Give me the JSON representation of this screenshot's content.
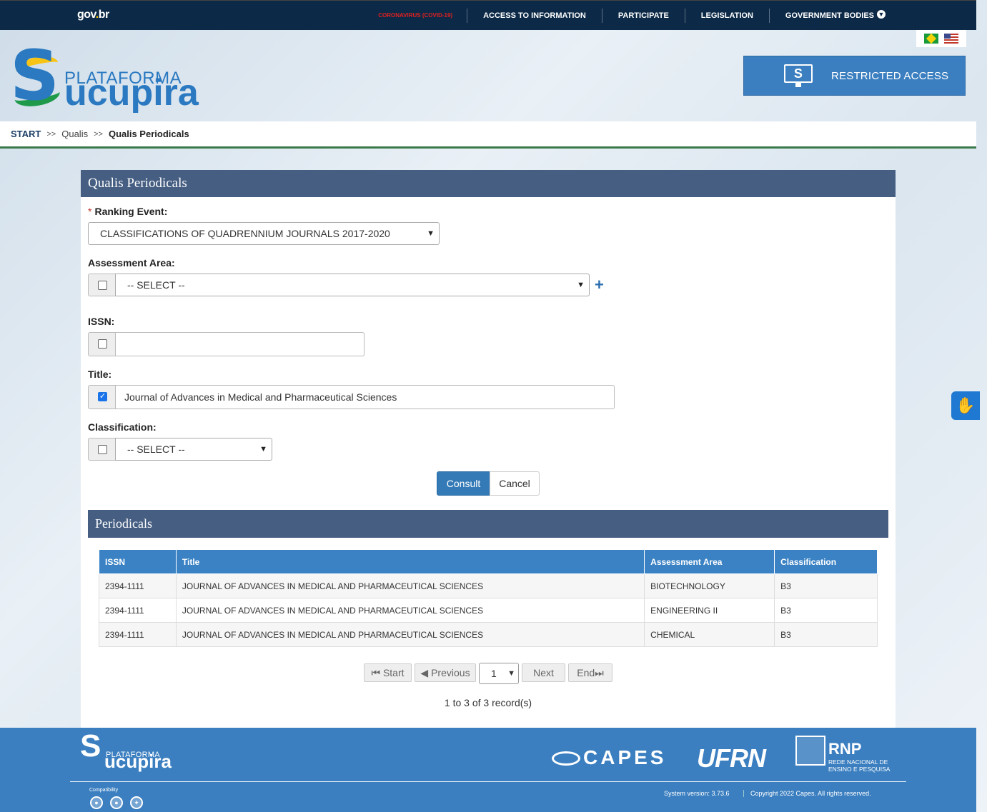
{
  "govbar": {
    "logo_main": "gov",
    "logo_dot": ".",
    "logo_suffix": "br",
    "nav": [
      {
        "label": "CORONAVIRUS (COVID-19)"
      },
      {
        "label": "ACCESS TO INFORMATION"
      },
      {
        "label": "PARTICIPATE"
      },
      {
        "label": "LEGISLATION"
      },
      {
        "label": "GOVERNMENT BODIES"
      }
    ],
    "nav_color_covid": "#e02020"
  },
  "header": {
    "logo_letter": "S",
    "logo_plataforma": "PLATAFORMA",
    "logo_name": "ucupira",
    "restricted_label": "RESTRICTED ACCESS",
    "restricted_icon_letter": "S",
    "flags": [
      "flag-brazil-icon",
      "flag-usa-icon"
    ]
  },
  "breadcrumb": {
    "start": "START",
    "sep1": ">>",
    "mid": "Qualis",
    "sep2": ">>",
    "current": "Qualis Periodicals"
  },
  "form": {
    "title": "Qualis Periodicals",
    "ranking_event": {
      "required_mark": "*",
      "label": "Ranking Event:",
      "value": "CLASSIFICATIONS OF QUADRENNIUM JOURNALS 2017-2020"
    },
    "assessment_area": {
      "label": "Assessment Area:",
      "value": "-- SELECT --",
      "checked": false,
      "add": "+"
    },
    "issn": {
      "label": "ISSN:",
      "value": "",
      "checked": false
    },
    "title_field": {
      "label": "Title:",
      "value": "Journal of Advances in Medical and Pharmaceutical Sciences",
      "checked": true,
      "check_mark": "✓"
    },
    "classification": {
      "label": "Classification:",
      "value": "-- SELECT --",
      "checked": false
    },
    "consult_label": "Consult",
    "cancel_label": "Cancel"
  },
  "results": {
    "title": "Periodicals",
    "columns": [
      "ISSN",
      "Title",
      "Assessment Area",
      "Classification"
    ],
    "rows": [
      [
        "2394-1111",
        "JOURNAL OF ADVANCES IN MEDICAL AND PHARMACEUTICAL SCIENCES",
        "BIOTECHNOLOGY",
        "B3"
      ],
      [
        "2394-1111",
        "JOURNAL OF ADVANCES IN MEDICAL AND PHARMACEUTICAL SCIENCES",
        "ENGINEERING II",
        "B3"
      ],
      [
        "2394-1111",
        "JOURNAL OF ADVANCES IN MEDICAL AND PHARMACEUTICAL SCIENCES",
        "CHEMICAL",
        "B3"
      ]
    ],
    "pager": {
      "start": "Start",
      "previous": "Previous",
      "page": "1",
      "next": "Next",
      "end": "End"
    },
    "records": "1 to 3 of 3 record(s)"
  },
  "accessibility_icon": "sign-language-hand-icon",
  "footer": {
    "logo_letter": "S",
    "logo_plataforma": "PLATAFORMA",
    "logo_name": "ucupira",
    "capes": "CAPES",
    "ufrn": "UFRN",
    "rnp_big": "RNP",
    "rnp_small": "REDE NACIONAL DE ENSINO E PESQUISA",
    "compat_label": "Compatibility",
    "browsers": [
      "chrome-icon",
      "firefox-icon",
      "safari-icon"
    ],
    "system_version": "System version: 3.73.6",
    "copyright": "Copyright 2022 Capes. All rights reserved."
  },
  "colors": {
    "govbar_bg": "#0c2a47",
    "panel_header": "#455e82",
    "table_header": "#3a82c4",
    "primary_button": "#337ab7",
    "footer_bg": "#3b7fc0"
  }
}
